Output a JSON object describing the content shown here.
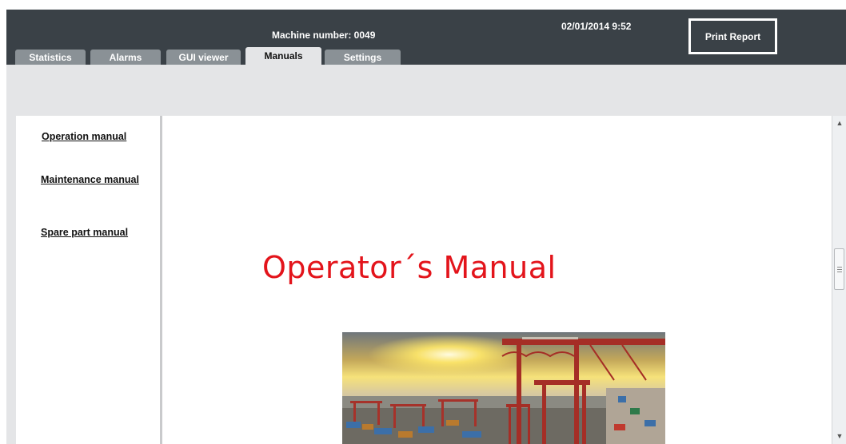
{
  "header": {
    "machine_number": "Machine number: 0049",
    "datetime": "02/01/2014 9:52",
    "print_report": "Print Report"
  },
  "tabs": [
    {
      "label": "Statistics",
      "active": false
    },
    {
      "label": "Alarms",
      "active": false
    },
    {
      "label": "GUI viewer",
      "active": false
    },
    {
      "label": "Manuals",
      "active": true
    },
    {
      "label": "Settings",
      "active": false
    }
  ],
  "manuals_nav": [
    {
      "label": "Operation manual"
    },
    {
      "label": "Maintenance manual"
    },
    {
      "label": "Spare part manual"
    }
  ],
  "document": {
    "title": "Operator´s Manual",
    "image_icon": "port-cranes-photo",
    "title_color": "#e3141b"
  },
  "scrollbar": {
    "up_icon": "scroll-up-arrow-icon",
    "down_icon": "scroll-down-arrow-icon"
  },
  "colors": {
    "header_bg": "#3a4147",
    "tab_bg": "#8a9196",
    "panel_bg": "#e4e5e7"
  }
}
